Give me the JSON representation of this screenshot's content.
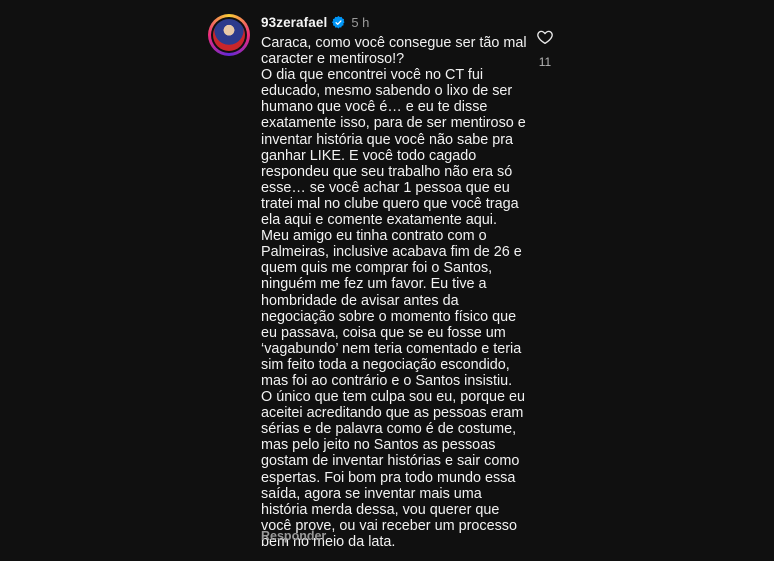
{
  "comment": {
    "username": "93zerafael",
    "time": "5 h",
    "text": "Caraca, como você consegue ser tão mal caracter e mentiroso!?\nO dia que encontrei você no CT fui educado, mesmo sabendo o lixo de ser humano que você é… e eu te disse exatamente isso, para de ser mentiroso e inventar história que você não sabe pra ganhar LIKE. E você todo cagado respondeu que seu trabalho não era só esse… se você achar 1 pessoa que eu tratei mal no clube quero que você traga ela aqui e comente exatamente aqui.\nMeu amigo eu tinha contrato com o Palmeiras, inclusive acabava fim de 26 e quem quis me comprar foi o Santos, ninguém me fez um favor. Eu tive a hombridade de avisar antes da negociação sobre o momento físico que eu passava, coisa que se eu fosse um ‘vagabundo’ nem teria comentado e teria sim feito toda a negociação escondido, mas foi ao contrário e o Santos insistiu.\nO único que tem culpa sou eu, porque eu aceitei acreditando que as pessoas eram sérias e de palavra como é de costume, mas pelo jeito no Santos as pessoas gostam de inventar histórias e sair como espertas. Foi bom pra todo mundo essa saída, agora se inventar mais uma história merda dessa, vou querer que você prove, ou vai receber um processo bem no meio da lata.",
    "reply_label": "Responder",
    "like_count": "11",
    "verified_icon": "verified-badge-icon",
    "like_icon": "heart-outline-icon",
    "verified_color": "#0095f6",
    "background_color": "#101010"
  }
}
